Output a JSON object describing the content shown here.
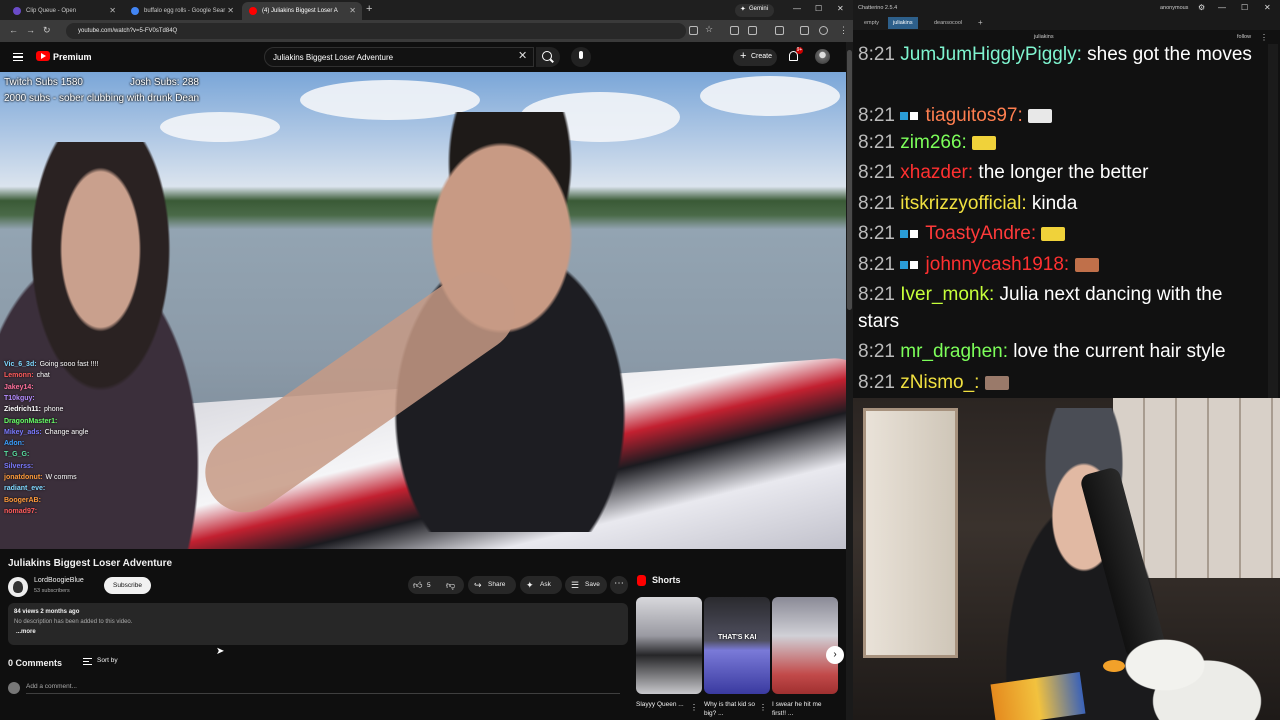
{
  "browser": {
    "tabs": [
      {
        "label": "Clip Queue - Open",
        "color": "#6a4bc8"
      },
      {
        "label": "buffalo egg rolls - Google Sear",
        "color": "#4285f4"
      },
      {
        "label": "(4) Juliakins Biggest Loser A",
        "color": "#ff0000"
      }
    ],
    "gemini_label": "Gemini",
    "url": "youtube.com/watch?v=5-FV0sTd84Q"
  },
  "youtube": {
    "brand": "Premium",
    "search_value": "Juliakins Biggest Loser Adventure",
    "create_label": "Create",
    "notification_count": "9+",
    "overlay": {
      "twitch_subs": "Twitch Subs 1580",
      "josh_subs": "Josh Subs: 288",
      "goal": "2000 subs - sober clubbing with drunk Dean"
    },
    "video_chat": [
      {
        "user": "Vic_6_3d:",
        "text": "Going sooo fast !!!!",
        "color": "#7fd8ff"
      },
      {
        "user": "Lemonn:",
        "text": "chat",
        "color": "#ff5b5b"
      },
      {
        "user": "Jakey14:",
        "text": "",
        "color": "#ff6f9b"
      },
      {
        "user": "T10kguy:",
        "text": "",
        "color": "#b58cff"
      },
      {
        "user": "Ziedrich11:",
        "text": "phone",
        "color": "#ffffff"
      },
      {
        "user": "DragonMaster1:",
        "text": "",
        "color": "#66ff66"
      },
      {
        "user": "Mikey_ads:",
        "text": "Change angle",
        "color": "#7a7aff"
      },
      {
        "user": "Adon:",
        "text": "",
        "color": "#3aa0ff"
      },
      {
        "user": "T_G_G:",
        "text": "",
        "color": "#58e0a0"
      },
      {
        "user": "Silverss:",
        "text": "",
        "color": "#7a7aff"
      },
      {
        "user": "jonatdonut:",
        "text": "W comms",
        "color": "#ff9b3a"
      },
      {
        "user": "radiant_eve:",
        "text": "",
        "color": "#7fd8ff"
      },
      {
        "user": "BoogerAB:",
        "text": "",
        "color": "#ff9b3a"
      },
      {
        "user": "nomad97:",
        "text": "",
        "color": "#ff5b5b"
      }
    ],
    "title": "Juliakins Biggest Loser Adventure",
    "channel": "LordBoogieBlue",
    "subscribers": "53 subscribers",
    "subscribe_label": "Subscribe",
    "like_count": "5",
    "share_label": "Share",
    "ask_label": "Ask",
    "save_label": "Save",
    "description": {
      "meta": "84 views  2 months ago",
      "text": "No description has been added to this video.",
      "more": "...more"
    },
    "comments_label": "0 Comments",
    "sort_label": "Sort by",
    "add_comment_placeholder": "Add a comment...",
    "shorts_label": "Shorts",
    "shorts": [
      {
        "title": "Slayyy Queen ..."
      },
      {
        "title": "Why is that kid so big? ...",
        "thumb_text": "THAT'S KAI"
      },
      {
        "title": "I swear he hit me first!! ..."
      }
    ]
  },
  "chatterino": {
    "title": "Chatterino 2.5.4",
    "account": "anonymous",
    "tabs": [
      "empty",
      "juliakins",
      "deansocool"
    ],
    "channel": "juliakins",
    "follow_label": "follow",
    "messages": [
      {
        "time": "8:21",
        "user": "JumJumHigglyPiggly:",
        "user_color": "#7ff5d0",
        "text": "shes got the moves"
      },
      {
        "time": "8:21",
        "user": "tiaguitos97:",
        "user_color": "#ff7f50",
        "text": "",
        "badges": true,
        "emote": "#e8e8e8"
      },
      {
        "time": "8:21",
        "user": "zim266:",
        "user_color": "#7dff5a",
        "text": "",
        "emote": "#f0d23a"
      },
      {
        "time": "8:21",
        "user": "xhazder:",
        "user_color": "#ff3030",
        "text": "the longer the better"
      },
      {
        "time": "8:21",
        "user": "itskrizzyofficial:",
        "user_color": "#f0e040",
        "text": "kinda"
      },
      {
        "time": "8:21",
        "user": "ToastyAndre:",
        "user_color": "#ff3a3a",
        "text": "",
        "badges": true,
        "emote": "#f0d23a"
      },
      {
        "time": "8:21",
        "user": "johnnycash1918:",
        "user_color": "#ff3030",
        "text": "",
        "badges": true,
        "emote": "#c0704a"
      },
      {
        "time": "8:21",
        "user": "Iver_monk:",
        "user_color": "#c6ff3a",
        "text": "Julia next dancing with the stars"
      },
      {
        "time": "8:21",
        "user": "mr_draghen:",
        "user_color": "#7dff5a",
        "text": "love the current hair style"
      },
      {
        "time": "8:21",
        "user": "zNismo_:",
        "user_color": "#f0e040",
        "text": "",
        "emote": "#9a7a6a"
      }
    ]
  }
}
